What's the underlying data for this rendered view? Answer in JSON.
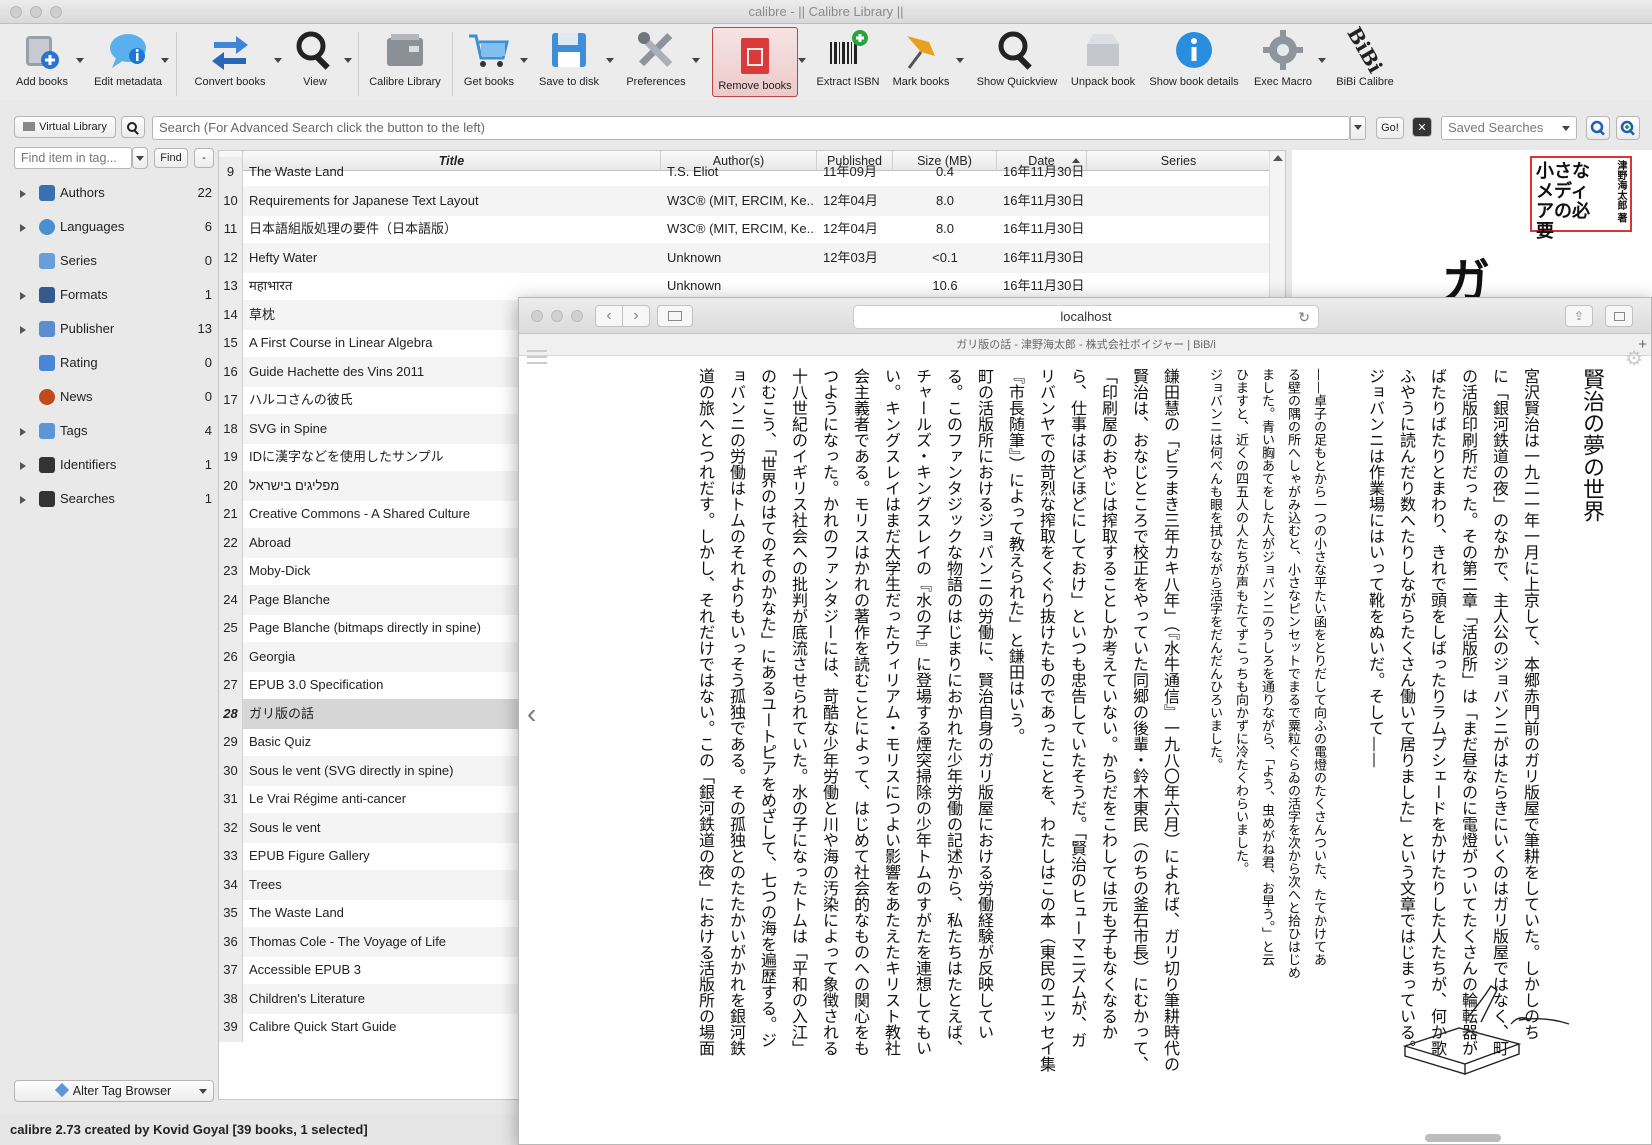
{
  "window": {
    "title": "calibre - || Calibre Library ||"
  },
  "toolbar": {
    "add_books": "Add books",
    "edit_metadata": "Edit metadata",
    "convert_books": "Convert books",
    "view": "View",
    "calibre_library": "Calibre Library",
    "get_books": "Get books",
    "save_to_disk": "Save to disk",
    "preferences": "Preferences",
    "remove_books": "Remove books",
    "extract_isbn": "Extract ISBN",
    "mark_books": "Mark books",
    "show_quickview": "Show Quickview",
    "unpack_book": "Unpack book",
    "show_book_details": "Show book details",
    "exec_macro": "Exec Macro",
    "bibi_calibre": "BiBi Calibre",
    "bibi_logo": "BiBi"
  },
  "search": {
    "virtual_library": "Virtual Library",
    "placeholder": "Search (For Advanced Search click the button to the left)",
    "go": "Go!",
    "saved_searches": "Saved Searches",
    "find_item_placeholder": "Find item in tag...",
    "find": "Find",
    "minus": "-"
  },
  "tag_browser": {
    "items": [
      {
        "name": "Authors",
        "count": "22",
        "expandable": true,
        "icon": "person-icon",
        "color": "#3a6fb0"
      },
      {
        "name": "Languages",
        "count": "6",
        "expandable": true,
        "icon": "globe-icon",
        "color": "#4a8fd0"
      },
      {
        "name": "Series",
        "count": "0",
        "expandable": false,
        "icon": "series-icon",
        "color": "#6a9ed8"
      },
      {
        "name": "Formats",
        "count": "1",
        "expandable": true,
        "icon": "book-icon",
        "color": "#375a8c"
      },
      {
        "name": "Publisher",
        "count": "13",
        "expandable": true,
        "icon": "house-icon",
        "color": "#5a8ed0"
      },
      {
        "name": "Rating",
        "count": "0",
        "expandable": false,
        "icon": "star-icon",
        "color": "#4a86d8"
      },
      {
        "name": "News",
        "count": "0",
        "expandable": false,
        "icon": "rss-icon",
        "color": "#c04a1a"
      },
      {
        "name": "Tags",
        "count": "4",
        "expandable": true,
        "icon": "tag-icon",
        "color": "#5a96d8"
      },
      {
        "name": "Identifiers",
        "count": "1",
        "expandable": true,
        "icon": "barcode-icon",
        "color": "#333333"
      },
      {
        "name": "Searches",
        "count": "1",
        "expandable": true,
        "icon": "search-icon",
        "color": "#333333"
      }
    ],
    "alter_button": "Alter Tag Browser"
  },
  "book_list": {
    "columns": [
      "Title",
      "Author(s)",
      "Published",
      "Size (MB)",
      "Date",
      "Series"
    ],
    "rows": [
      {
        "num": "9",
        "title": "The Waste Land",
        "author": "T.S. Eliot",
        "published": "11年09月",
        "size": "0.4",
        "date": "16年11月30日"
      },
      {
        "num": "10",
        "title": "Requirements for Japanese Text Layout",
        "author": "W3C® (MIT, ERCIM, Ke...",
        "published": "12年04月",
        "size": "8.0",
        "date": "16年11月30日"
      },
      {
        "num": "11",
        "title": "日本語組版処理の要件（日本語版）",
        "author": "W3C® (MIT, ERCIM, Ke...",
        "published": "12年04月",
        "size": "8.0",
        "date": "16年11月30日"
      },
      {
        "num": "12",
        "title": "Hefty Water",
        "author": "Unknown",
        "published": "12年03月",
        "size": "<0.1",
        "date": "16年11月30日"
      },
      {
        "num": "13",
        "title": "महाभारत",
        "author": "Unknown",
        "published": "",
        "size": "10.6",
        "date": "16年11月30日"
      },
      {
        "num": "14",
        "title": "草枕",
        "author": "",
        "published": "",
        "size": "",
        "date": ""
      },
      {
        "num": "15",
        "title": "A First Course in Linear Algebra",
        "author": "",
        "published": "",
        "size": "",
        "date": ""
      },
      {
        "num": "16",
        "title": "Guide Hachette des Vins 2011",
        "author": "",
        "published": "",
        "size": "",
        "date": ""
      },
      {
        "num": "17",
        "title": "ハルコさんの彼氏",
        "author": "",
        "published": "",
        "size": "",
        "date": ""
      },
      {
        "num": "18",
        "title": "SVG in Spine",
        "author": "",
        "published": "",
        "size": "",
        "date": ""
      },
      {
        "num": "19",
        "title": "IDに漢字などを使用したサンプル",
        "author": "",
        "published": "",
        "size": "",
        "date": ""
      },
      {
        "num": "20",
        "title": "מפליגים בישראל",
        "author": "",
        "published": "",
        "size": "",
        "date": ""
      },
      {
        "num": "21",
        "title": "Creative Commons - A Shared Culture",
        "author": "",
        "published": "",
        "size": "",
        "date": ""
      },
      {
        "num": "22",
        "title": "Abroad",
        "author": "",
        "published": "",
        "size": "",
        "date": ""
      },
      {
        "num": "23",
        "title": "Moby-Dick",
        "author": "",
        "published": "",
        "size": "",
        "date": ""
      },
      {
        "num": "24",
        "title": "Page Blanche",
        "author": "",
        "published": "",
        "size": "",
        "date": ""
      },
      {
        "num": "25",
        "title": "Page Blanche (bitmaps directly in spine)",
        "author": "",
        "published": "",
        "size": "",
        "date": ""
      },
      {
        "num": "26",
        "title": "Georgia",
        "author": "",
        "published": "",
        "size": "",
        "date": ""
      },
      {
        "num": "27",
        "title": "EPUB 3.0 Specification",
        "author": "",
        "published": "",
        "size": "",
        "date": ""
      },
      {
        "num": "28",
        "title": "ガリ版の話",
        "author": "",
        "published": "",
        "size": "",
        "date": ""
      },
      {
        "num": "29",
        "title": "Basic Quiz",
        "author": "",
        "published": "",
        "size": "",
        "date": ""
      },
      {
        "num": "30",
        "title": "Sous le vent (SVG directly in spine)",
        "author": "",
        "published": "",
        "size": "",
        "date": ""
      },
      {
        "num": "31",
        "title": "Le Vrai Régime anti-cancer",
        "author": "",
        "published": "",
        "size": "",
        "date": ""
      },
      {
        "num": "32",
        "title": "Sous le vent",
        "author": "",
        "published": "",
        "size": "",
        "date": ""
      },
      {
        "num": "33",
        "title": "EPUB Figure Gallery",
        "author": "",
        "published": "",
        "size": "",
        "date": ""
      },
      {
        "num": "34",
        "title": "Trees",
        "author": "",
        "published": "",
        "size": "",
        "date": ""
      },
      {
        "num": "35",
        "title": "The Waste Land",
        "author": "",
        "published": "",
        "size": "",
        "date": ""
      },
      {
        "num": "36",
        "title": "Thomas Cole - The Voyage of Life",
        "author": "",
        "published": "",
        "size": "",
        "date": ""
      },
      {
        "num": "37",
        "title": "Accessible EPUB 3",
        "author": "",
        "published": "",
        "size": "",
        "date": ""
      },
      {
        "num": "38",
        "title": "Children's Literature",
        "author": "",
        "published": "",
        "size": "",
        "date": ""
      },
      {
        "num": "39",
        "title": "Calibre Quick Start Guide",
        "author": "",
        "published": "",
        "size": "",
        "date": ""
      }
    ],
    "selected_num": "28"
  },
  "cover": {
    "title_text": "小さなメディアの必要",
    "author_text": "津野海太郎 著",
    "partial_glyph": "ガ"
  },
  "status": {
    "text": "calibre 2.73 created by Kovid Goyal    [39 books, 1 selected]"
  },
  "browser": {
    "url": "localhost",
    "tab_title": "ガリ版の話 - 津野海太郎 - 株式会社ボイジャー | BiB/i",
    "chapter_title": "賢治の夢の世界",
    "columns": [
      {
        "text": "宮沢賢治は一九二一年一月に上京して、本郷赤門前のガリ版屋で筆耕をしていた。しかしのち",
        "small": false
      },
      {
        "text": "に「銀河鉄道の夜」のなかで、主人公のジョバンニがはたらきにいくのはガリ版屋ではなく、町",
        "small": false
      },
      {
        "text": "の活版印刷所だった。その第二章「活版所」は「まだ昼なのに電燈がついてたくさんの輪転器が",
        "small": false
      },
      {
        "text": "ばたりばたりとまわり、きれで頭をしばったりラムプシェードをかけたりした人たちが、何か歌",
        "small": false
      },
      {
        "text": "ふやうに読んだり数へたりしながらたくさん働いて居りました」という文章ではじまっている。",
        "small": false
      },
      {
        "text": "ジョバンニは作業場にはいって靴をぬいだ。そして——",
        "small": false
      },
      {
        "text": "——卓子の足もとから一つの小さな平たい函をとりだして向ふの電燈のたくさんついた、たてかけてあ",
        "small": true
      },
      {
        "text": "る壁の隅の所へしゃがみ込むと、小さなピンセットでまるで粟粒ぐらゐの活字を次から次へと拾ひはじめ",
        "small": true
      },
      {
        "text": "ました。青い胸あてをした人がジョバンニのうしろを通りながら、「よう、虫めがね君、お早う。」と云",
        "small": true
      },
      {
        "text": "ひますと、近くの四五人の人たちが声もたてずこっちも向かずに冷たくわらいました。",
        "small": true
      },
      {
        "text": "ジョバンニは何べんも眼を拭ひながら活字をだんだんひろいました。",
        "small": true
      },
      {
        "text": "鎌田慧の「ビラまき三年カキ八年」（『水牛通信』一九八〇年六月）によれば、ガリ切り筆耕時代の",
        "small": false
      },
      {
        "text": "賢治は、おなじところで校正をやっていた同郷の後輩・鈴木東民（のちの釜石市長）にむかって、",
        "small": false
      },
      {
        "text": "「印刷屋のおやじは搾取することしか考えていない。からだをこわしては元も子もなくなるか",
        "small": false
      },
      {
        "text": "ら、仕事はほどほどにしておけ」といつも忠告していたそうだ。「賢治のヒューマニズムが、ガ",
        "small": false
      },
      {
        "text": "リバンヤでの苛烈な搾取をくぐり抜けたものであったことを、わたしはこの本（東民のエッセイ集",
        "small": false
      },
      {
        "text": "『市長随筆』）によって教えられた」と鎌田はいう。",
        "small": false
      },
      {
        "text": "町の活版所におけるジョバンニの労働に、賢治自身のガリ版屋における労働経験が反映してい",
        "small": false
      },
      {
        "text": "る。このファンタジックな物語のはじまりにおかれた少年労働の記述から、私たちはたとえば、",
        "small": false
      },
      {
        "text": "チャールズ・キングスレイの『水の子』に登場する煙突掃除の少年トムのすがたを連想してもい",
        "small": false
      },
      {
        "text": "い。キングスレイはまだ大学生だったウィリアム・モリスにつよい影響をあたえたキリスト教社",
        "small": false
      },
      {
        "text": "会主義者である。モリスはかれの著作を読むことによって、はじめて社会的なものへの関心をも",
        "small": false
      },
      {
        "text": "つようになった。かれのファンタジーには、苛酷な少年労働と川や海の汚染によって象徴される",
        "small": false
      },
      {
        "text": "十八世紀のイギリス社会への批判が底流させられていた。水の子になったトムは「平和の入江」",
        "small": false
      },
      {
        "text": "のむこう、「世界のはてのそのかなた」にあるユートピアをめざして、七つの海を遍歴する。ジ",
        "small": false
      },
      {
        "text": "ョバンニの労働はトムのそれよりもいっそう孤独である。その孤独とのたたかいがかれを銀河鉄",
        "small": false
      },
      {
        "text": "道の旅へとつれだす。しかし、それだけではない。この「銀河鉄道の夜」における活版所の場面",
        "small": false
      }
    ]
  }
}
